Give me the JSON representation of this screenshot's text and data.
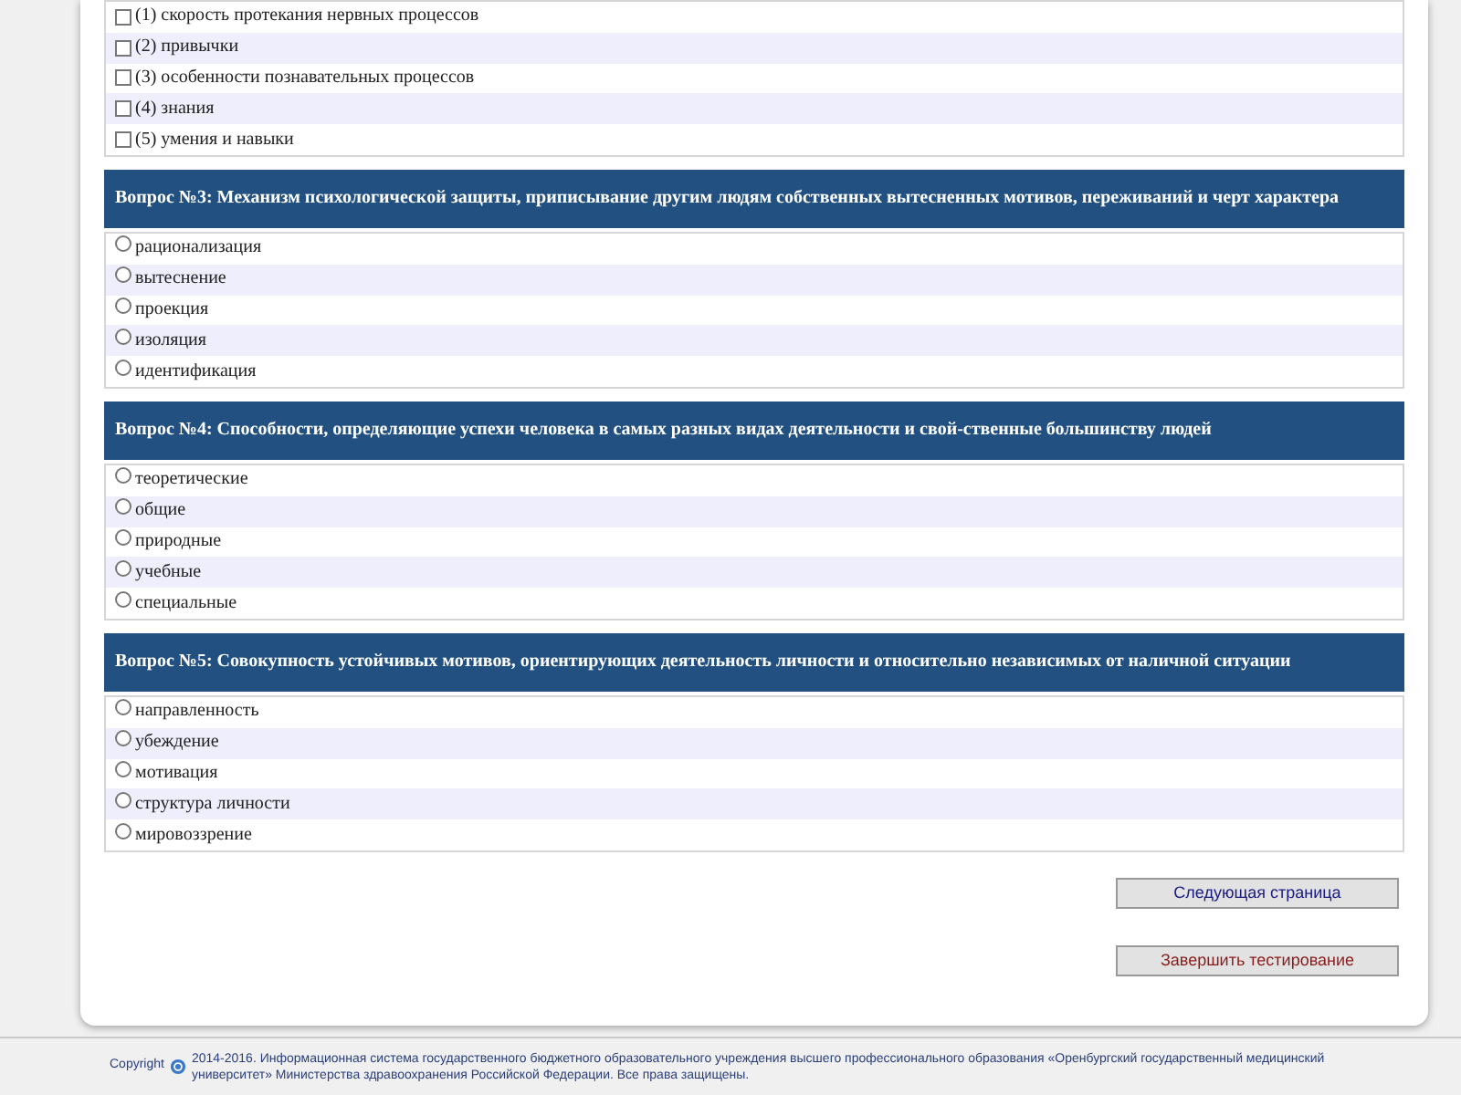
{
  "questions": [
    {
      "kind": "checkbox",
      "options": [
        {
          "label": "(1) скорость протекания нервных процессов",
          "checked": false
        },
        {
          "label": "(2) привычки",
          "checked": false
        },
        {
          "label": "(3) особенности познавательных процессов",
          "checked": false
        },
        {
          "label": "(4) знания",
          "checked": false
        },
        {
          "label": "(5) умения и навыки",
          "checked": false
        }
      ]
    },
    {
      "kind": "radio",
      "title": "Вопрос №3: Механизм психологической защиты, приписывание другим людям собственных вытесненных мотивов, переживаний и черт характера",
      "options": [
        {
          "label": "рационализация",
          "checked": false
        },
        {
          "label": "вытеснение",
          "checked": false
        },
        {
          "label": "проекция",
          "checked": false
        },
        {
          "label": "изоляция",
          "checked": false
        },
        {
          "label": "идентификация",
          "checked": false
        }
      ]
    },
    {
      "kind": "radio",
      "title": "Вопрос №4: Способности, определяющие успехи человека в самых разных видах деятельности и свой-ственные большинству людей",
      "options": [
        {
          "label": "теоретические",
          "checked": false
        },
        {
          "label": "общие",
          "checked": false
        },
        {
          "label": "природные",
          "checked": false
        },
        {
          "label": "учебные",
          "checked": false
        },
        {
          "label": "специальные",
          "checked": false
        }
      ]
    },
    {
      "kind": "radio",
      "title": "Вопрос №5: Совокупность устойчивых мотивов, ориентирующих деятельность личности и относительно независимых от наличной ситуации",
      "options": [
        {
          "label": "направленность",
          "checked": false
        },
        {
          "label": "убеждение",
          "checked": false
        },
        {
          "label": "мотивация",
          "checked": false
        },
        {
          "label": "структура личности",
          "checked": false
        },
        {
          "label": "мировоззрение",
          "checked": false
        }
      ]
    }
  ],
  "buttons": [
    {
      "kind": "next",
      "label": "Следующая страница"
    },
    {
      "kind": "finish",
      "label": "Завершить тестирование"
    }
  ],
  "footer": {
    "copyright": "Copyright",
    "text": "2014-2016. Информационная система государственного бюджетного образовательного учреждения высшего профессионального образования «Оренбургский государственный медицинский университет» Министерства здравоохранения Российской Федерации. Все права защищены."
  }
}
